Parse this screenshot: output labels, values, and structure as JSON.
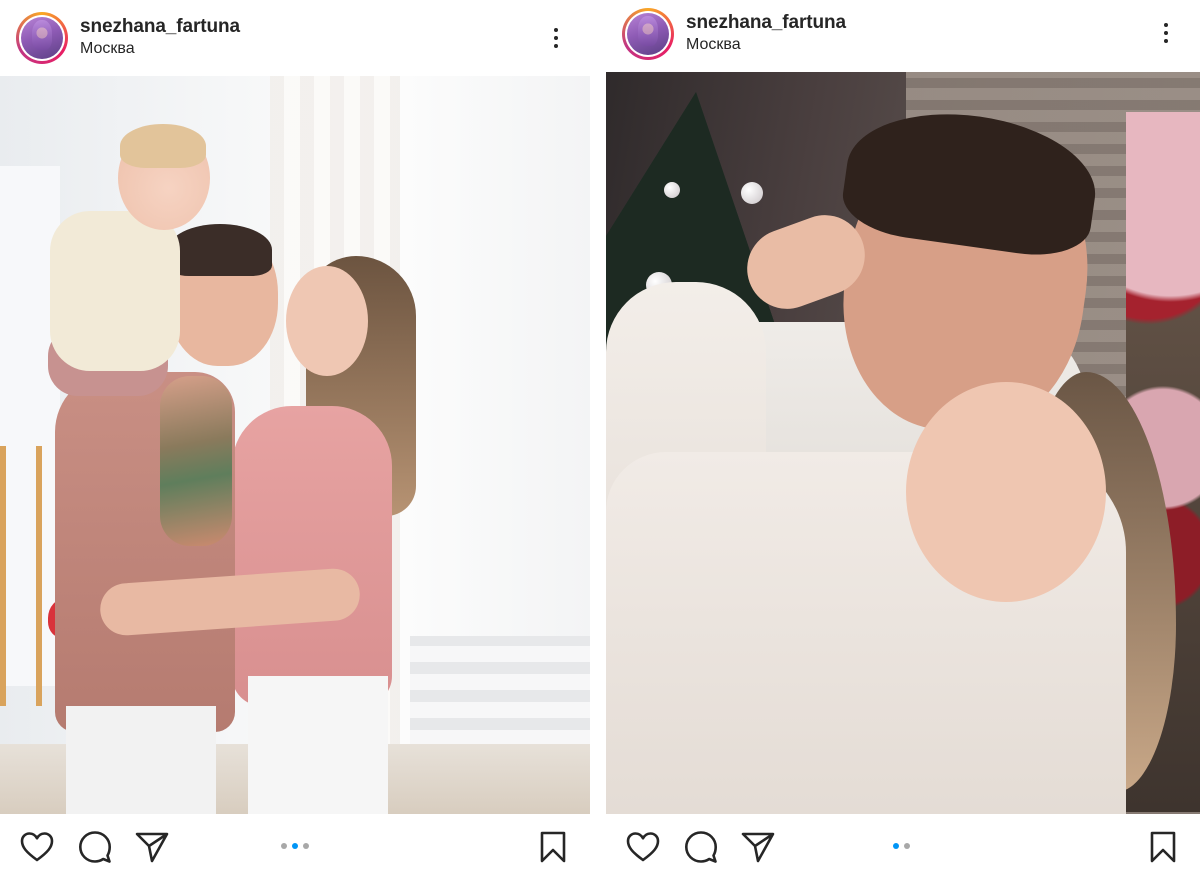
{
  "posts": [
    {
      "username": "snezhana_fartuna",
      "location": "Москва",
      "carousel": {
        "count": 3,
        "active_index": 1
      },
      "icons": {
        "more": "more-vertical-icon",
        "like": "heart-outline-icon",
        "comment": "comment-bubble-icon",
        "share": "paper-plane-icon",
        "save": "bookmark-outline-icon"
      }
    },
    {
      "username": "snezhana_fartuna",
      "location": "Москва",
      "carousel": {
        "count": 2,
        "active_index": 0
      },
      "icons": {
        "more": "more-vertical-icon",
        "like": "heart-outline-icon",
        "comment": "comment-bubble-icon",
        "share": "paper-plane-icon",
        "save": "bookmark-outline-icon"
      }
    }
  ],
  "colors": {
    "text": "#262626",
    "dot_active": "#0095f6",
    "dot_inactive": "#a8a8a8",
    "avatar_ring": [
      "#f9a825",
      "#e91e63",
      "#c13584"
    ]
  }
}
